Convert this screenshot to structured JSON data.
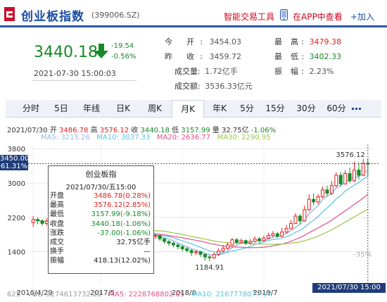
{
  "header": {
    "title": "创业板指数",
    "code": "(399006.SZ)",
    "smart_tool": "智能交易工具",
    "app_link": "在APP中查看",
    "add_label": "+加入"
  },
  "quote": {
    "price": "3440.18",
    "change": "-19.54",
    "change_pct": "-0.56%",
    "time": "2021-07-30 15:00:03",
    "open_label": "今  开:",
    "open": "3454.03",
    "prev_label": "昨  收:",
    "prev_close": "3459.72",
    "vol_label": "成交量:",
    "volume": "1.72亿手",
    "amt_label": "成交额:",
    "amount": "3536.33亿元",
    "high_label": "最  高:",
    "high": "3479.38",
    "low_label": "最  低:",
    "low": "3402.33",
    "amp_label": "振  幅:",
    "amplitude": "2.23%"
  },
  "tabs": [
    "分时",
    "5日",
    "年线",
    "日K",
    "周K",
    "月K",
    "年K",
    "5分",
    "15分",
    "30分",
    "60分"
  ],
  "active_tab": "月K",
  "ohlc_row": {
    "date": "2021/07/30",
    "o_label": "开",
    "o": "3486.78",
    "h_label": "高",
    "h": "3576.12",
    "c_label": "收",
    "c": "3440.18",
    "l_label": "低",
    "l": "3157.99",
    "v_label": "量",
    "v": "32.75亿",
    "pct": "-1.06%"
  },
  "ma_row": {
    "ma5": "MA5: 3215.26",
    "ma10": "MA10: 3037.33",
    "ma20": "MA20: 2636.77",
    "ma30": "MA30: 2290.95"
  },
  "cursor_tag": {
    "price": "3450.00",
    "pct": "61.31%"
  },
  "tooltip": {
    "name": "创业板指",
    "date": "2021/07/30/五15:00",
    "rows": [
      {
        "k": "开盘",
        "v": "3486.78(0.28%)",
        "color": "red"
      },
      {
        "k": "最高",
        "v": "3576.12(2.85%)",
        "color": "red"
      },
      {
        "k": "最低",
        "v": "3157.99(-9.18%)",
        "color": "green"
      },
      {
        "k": "收盘",
        "v": "3440.18(-1.06%)",
        "color": "green"
      },
      {
        "k": "涨跌",
        "v": "-37.00(-1.06%)",
        "color": "green"
      },
      {
        "k": "成交",
        "v": "32.75亿手",
        "color": "black"
      },
      {
        "k": "换手",
        "v": "—",
        "color": "black"
      },
      {
        "k": "振幅",
        "v": "418.13(12.02%)",
        "color": "black"
      }
    ]
  },
  "bottom_date_tag": "2021/07/30 15:00",
  "vol_row": {
    "vol": "VOL: 3274613732.22",
    "ma5": "MA5: 2228768802.05",
    "ma10": "MA10: 2167778077.97"
  },
  "chart_data": {
    "type": "candlestick",
    "y_ticks": [
      "3800",
      "3000",
      "2200",
      "1400"
    ],
    "x_ticks": [
      "2016/4/29",
      "2017/5",
      "2018/6",
      "2019/7"
    ],
    "right_pct_ticks": [
      "-35%"
    ],
    "y_bottom_label": "625",
    "annotations": {
      "max": "3576.12",
      "min": "1184.91"
    },
    "ylim": [
      625,
      3900
    ],
    "colors": {
      "up": "#e02020",
      "down": "#168a27",
      "ma5": "#7fb0e0",
      "ma10": "#5bc0de",
      "ma20": "#e54d8a",
      "ma30": "#9ac84a"
    },
    "candles": [
      [
        2080,
        2150,
        2230,
        1980
      ],
      [
        2150,
        2120,
        2200,
        2040
      ],
      [
        2120,
        2060,
        2160,
        2000
      ],
      [
        2060,
        2110,
        2180,
        2010
      ],
      [
        2110,
        2050,
        2140,
        1990
      ],
      [
        2050,
        2080,
        2140,
        2000
      ],
      [
        2080,
        2020,
        2110,
        1950
      ],
      [
        2020,
        1960,
        2060,
        1900
      ],
      [
        1960,
        1940,
        2000,
        1870
      ],
      [
        1940,
        1900,
        1990,
        1840
      ],
      [
        1900,
        1960,
        2010,
        1880
      ],
      [
        1960,
        1920,
        2000,
        1870
      ],
      [
        1920,
        1880,
        1950,
        1820
      ],
      [
        1880,
        1820,
        1900,
        1760
      ],
      [
        1820,
        1780,
        1850,
        1720
      ],
      [
        1780,
        1820,
        1880,
        1740
      ],
      [
        1820,
        1760,
        1850,
        1700
      ],
      [
        1760,
        1740,
        1800,
        1680
      ],
      [
        1740,
        1790,
        1830,
        1700
      ],
      [
        1790,
        1800,
        1860,
        1750
      ],
      [
        1800,
        1740,
        1840,
        1700
      ],
      [
        1740,
        1820,
        1880,
        1700
      ],
      [
        1820,
        1880,
        1940,
        1790
      ],
      [
        1880,
        1850,
        1920,
        1790
      ],
      [
        1850,
        1760,
        1880,
        1700
      ],
      [
        1760,
        1730,
        1790,
        1680
      ],
      [
        1730,
        1760,
        1810,
        1690
      ],
      [
        1760,
        1780,
        1820,
        1700
      ],
      [
        1780,
        1700,
        1800,
        1650
      ],
      [
        1700,
        1640,
        1720,
        1580
      ],
      [
        1640,
        1600,
        1670,
        1530
      ],
      [
        1600,
        1560,
        1640,
        1500
      ],
      [
        1560,
        1520,
        1600,
        1460
      ],
      [
        1520,
        1470,
        1560,
        1410
      ],
      [
        1470,
        1430,
        1510,
        1380
      ],
      [
        1430,
        1380,
        1460,
        1300
      ],
      [
        1380,
        1400,
        1440,
        1320
      ],
      [
        1400,
        1340,
        1420,
        1280
      ],
      [
        1340,
        1280,
        1360,
        1200
      ],
      [
        1280,
        1260,
        1320,
        1185
      ],
      [
        1260,
        1340,
        1380,
        1230
      ],
      [
        1340,
        1420,
        1480,
        1300
      ],
      [
        1420,
        1480,
        1560,
        1390
      ],
      [
        1480,
        1560,
        1620,
        1440
      ],
      [
        1560,
        1680,
        1720,
        1530
      ],
      [
        1680,
        1620,
        1720,
        1580
      ],
      [
        1620,
        1660,
        1710,
        1590
      ],
      [
        1660,
        1600,
        1690,
        1560
      ],
      [
        1600,
        1640,
        1700,
        1570
      ],
      [
        1640,
        1700,
        1760,
        1610
      ],
      [
        1700,
        1660,
        1740,
        1620
      ],
      [
        1660,
        1720,
        1780,
        1630
      ],
      [
        1720,
        1780,
        1840,
        1690
      ],
      [
        1780,
        1820,
        1880,
        1740
      ],
      [
        1820,
        1760,
        1860,
        1730
      ],
      [
        1760,
        1860,
        1960,
        1740
      ],
      [
        1860,
        1940,
        2020,
        1830
      ],
      [
        1940,
        2060,
        2140,
        1920
      ],
      [
        2060,
        2230,
        2300,
        2040
      ],
      [
        2230,
        2120,
        2280,
        2040
      ],
      [
        2120,
        2380,
        2480,
        2100
      ],
      [
        2380,
        2620,
        2740,
        2340
      ],
      [
        2620,
        2560,
        2760,
        2480
      ],
      [
        2560,
        2680,
        2740,
        2500
      ],
      [
        2680,
        2840,
        2920,
        2640
      ],
      [
        2840,
        2760,
        2940,
        2700
      ],
      [
        2760,
        2940,
        3050,
        2720
      ],
      [
        2940,
        3180,
        3250,
        2900
      ],
      [
        3180,
        2980,
        3260,
        2920
      ],
      [
        2980,
        3220,
        3300,
        2960
      ],
      [
        3220,
        3050,
        3360,
        3000
      ],
      [
        3050,
        3300,
        3500,
        3020
      ],
      [
        3300,
        3180,
        3480,
        3080
      ],
      [
        3180,
        3460,
        3560,
        3160
      ],
      [
        3460,
        3440,
        3576,
        3158
      ]
    ]
  }
}
